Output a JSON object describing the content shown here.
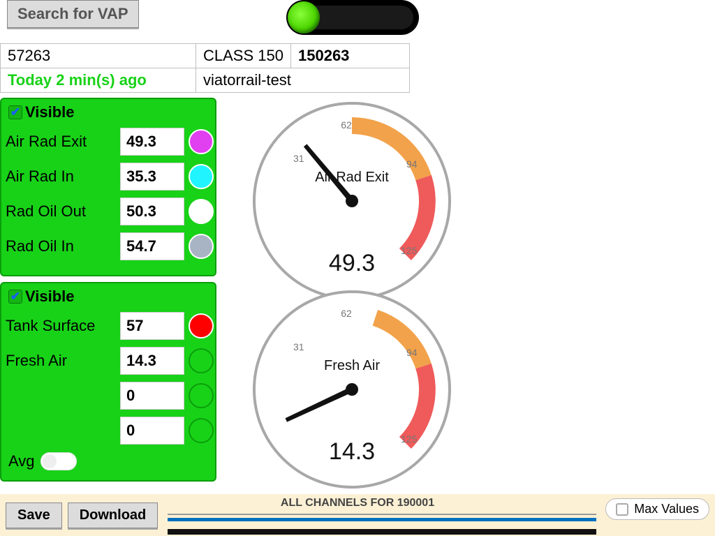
{
  "header": {
    "search_button_label": "Search for VAP",
    "toggle_state": true
  },
  "info": {
    "id": "57263",
    "class_name": "CLASS 150",
    "class_number": "150263",
    "when": "Today 2 min(s) ago",
    "site": "viatorrail-test"
  },
  "panel1": {
    "visible_label": "Visible",
    "visible_checked": true,
    "channels": [
      {
        "name": "Air Rad Exit",
        "value": "49.3",
        "color": "#e040f0"
      },
      {
        "name": "Air Rad In",
        "value": "35.3",
        "color": "#20f4ff"
      },
      {
        "name": "Rad Oil Out",
        "value": "50.3",
        "color": "#ffffff"
      },
      {
        "name": "Rad Oil In",
        "value": "54.7",
        "color": "#a8b4c4"
      }
    ]
  },
  "panel2": {
    "visible_label": "Visible",
    "visible_checked": true,
    "channels": [
      {
        "name": "Tank Surface",
        "value": "57",
        "color": "#ff0000"
      },
      {
        "name": "Fresh Air",
        "value": "14.3",
        "color": "#18d218"
      },
      {
        "name": "",
        "value": "0",
        "color": "#18d218"
      },
      {
        "name": "",
        "value": "0",
        "color": "#18d218"
      }
    ],
    "avg_label": "Avg",
    "avg_state": false
  },
  "gauge1": {
    "title": "Air Rad Exit",
    "value": "49.3",
    "ticks": {
      "t31": "31",
      "t62": "62",
      "t94": "94",
      "t125": "125"
    },
    "zones": [
      {
        "from": 62,
        "to": 94,
        "color": "#f2a24a"
      },
      {
        "from": 94,
        "to": 125,
        "color": "#ef5a5a"
      }
    ],
    "needle_angle_deg": -40
  },
  "gauge2": {
    "title": "Fresh Air",
    "value": "14.3",
    "ticks": {
      "t31": "31",
      "t62": "62",
      "t94": "94",
      "t125": "125"
    },
    "zones": [
      {
        "from": 70,
        "to": 94,
        "color": "#f2a24a"
      },
      {
        "from": 94,
        "to": 125,
        "color": "#ef5a5a"
      }
    ],
    "needle_angle_deg": -115
  },
  "bottom": {
    "save_label": "Save",
    "download_label": "Download",
    "chart_title": "ALL CHANNELS FOR 190001",
    "max_values_label": "Max Values",
    "max_values_checked": false
  },
  "chart_data": {
    "type": "gauge",
    "gauges": [
      {
        "title": "Air Rad Exit",
        "value": 49.3,
        "min": 0,
        "max": 125,
        "ticks": [
          31,
          62,
          94,
          125
        ],
        "zones": [
          {
            "from": 62,
            "to": 94,
            "color": "#f2a24a"
          },
          {
            "from": 94,
            "to": 125,
            "color": "#ef5a5a"
          }
        ]
      },
      {
        "title": "Fresh Air",
        "value": 14.3,
        "min": 0,
        "max": 125,
        "ticks": [
          31,
          62,
          94,
          125
        ],
        "zones": [
          {
            "from": 70,
            "to": 94,
            "color": "#f2a24a"
          },
          {
            "from": 94,
            "to": 125,
            "color": "#ef5a5a"
          }
        ]
      }
    ]
  }
}
